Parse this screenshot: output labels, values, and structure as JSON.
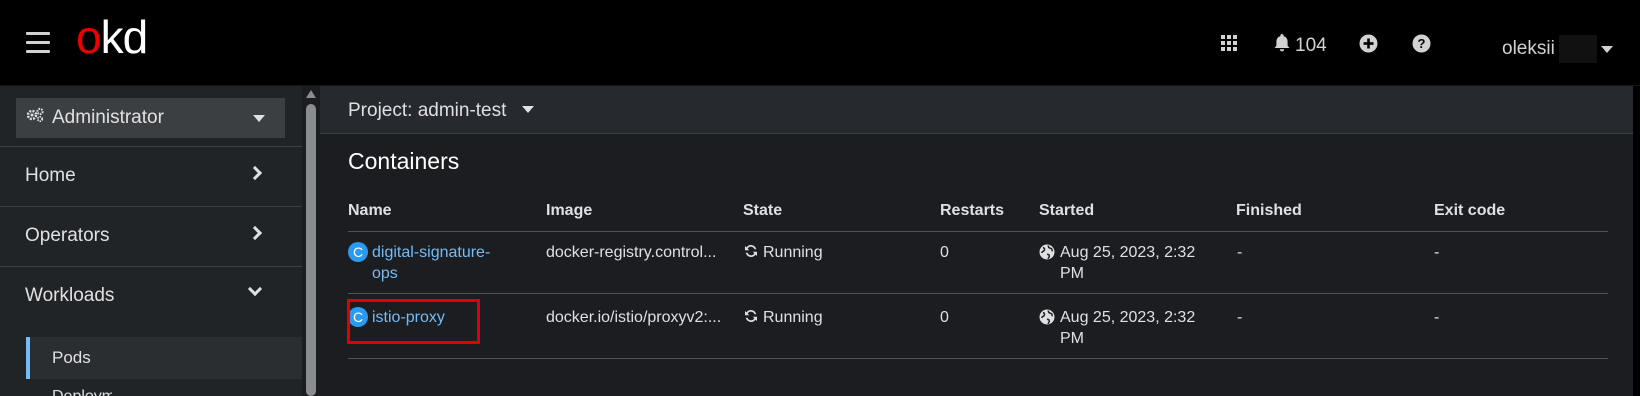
{
  "masthead": {
    "logo_o": "o",
    "logo_rest": "kd",
    "notification_count": "104",
    "user_name": "oleksii",
    "icons": [
      "hamburger-icon",
      "app-launcher-icon",
      "bell-icon",
      "plus-circle-icon",
      "help-icon"
    ]
  },
  "sidebar": {
    "perspective": "Administrator",
    "items": [
      {
        "label": "Home"
      },
      {
        "label": "Operators"
      },
      {
        "label": "Workloads"
      }
    ],
    "subitems": [
      {
        "label": "Pods"
      },
      {
        "label": "Deployments"
      }
    ]
  },
  "project": {
    "label": "Project: admin-test"
  },
  "containers": {
    "title": "Containers",
    "columns": [
      "Name",
      "Image",
      "State",
      "Restarts",
      "Started",
      "Finished",
      "Exit code"
    ],
    "rows": [
      {
        "badge": "C",
        "name_line1": "digital-signature-",
        "name_line2": "ops",
        "image": "docker-registry.control...",
        "state": "Running",
        "restarts": "0",
        "started_line1": "Aug 25, 2023, 2:32",
        "started_line2": "PM",
        "finished": "-",
        "exit_code": "-"
      },
      {
        "badge": "C",
        "name_line1": "istio-proxy",
        "image": "docker.io/istio/proxyv2:...",
        "state": "Running",
        "restarts": "0",
        "started_line1": "Aug 25, 2023, 2:32",
        "started_line2": "PM",
        "finished": "-",
        "exit_code": "-"
      }
    ]
  },
  "colors": {
    "brand_red": "#ee0000",
    "link_blue": "#73bcf7",
    "badge_blue": "#2b9af3",
    "highlight_red": "#e00000"
  }
}
